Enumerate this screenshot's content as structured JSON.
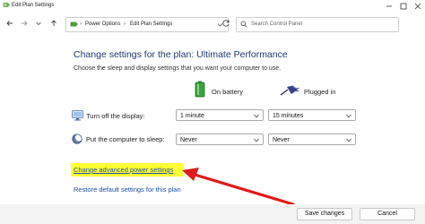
{
  "window": {
    "title": "Edit Plan Settings"
  },
  "address": {
    "segments": [
      "Power Options",
      "Edit Plan Settings"
    ],
    "search_placeholder": "Search Control Panel"
  },
  "main": {
    "heading": "Change settings for the plan: Ultimate Performance",
    "subtext": "Choose the sleep and display settings that you want your computer to use.",
    "columns": {
      "battery": "On battery",
      "plugged": "Plugged in"
    },
    "rows": [
      {
        "label": "Turn off the display:",
        "battery_value": "1 minute",
        "plugged_value": "15 minutes"
      },
      {
        "label": "Put the computer to sleep:",
        "battery_value": "Never",
        "plugged_value": "Never"
      }
    ],
    "advanced_link": "Change advanced power settings",
    "restore_link": "Restore default settings for this plan"
  },
  "footer": {
    "save_label": "Save changes",
    "cancel_label": "Cancel"
  },
  "colors": {
    "heading": "#1e3a6e",
    "link": "#1d4fa8",
    "highlight": "#ffff33",
    "arrow": "#e01b1b"
  }
}
